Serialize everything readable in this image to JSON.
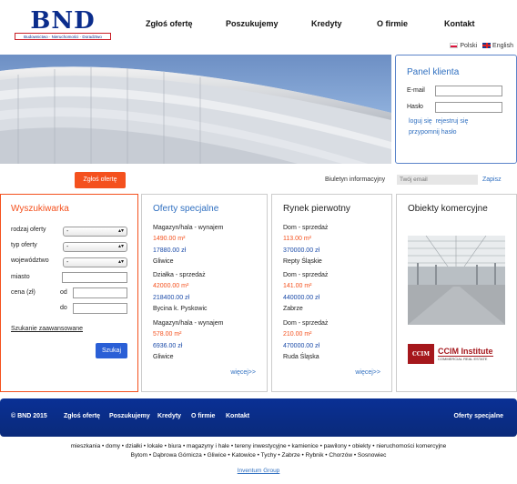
{
  "brand": {
    "name": "BND",
    "tagline": "Budownictwo · Nieruchomości · Doradztwo"
  },
  "nav": [
    "Zgłoś ofertę",
    "Poszukujemy",
    "Kredyty",
    "O firmie",
    "Kontakt"
  ],
  "languages": [
    "Polski",
    "English"
  ],
  "login": {
    "title": "Panel klienta",
    "email_label": "E-mail",
    "password_label": "Hasło",
    "login_link": "loguj się",
    "register_link": "rejestruj się",
    "remind_link": "przypomnij hasło"
  },
  "submit_offer_button": "Zgłoś ofertę",
  "newsletter": {
    "label": "Biuletyn informacyjny",
    "placeholder": "Twój email",
    "button": "Zapisz"
  },
  "search": {
    "title": "Wyszukiwarka",
    "fields": [
      {
        "label": "rodzaj oferty",
        "value": "-"
      },
      {
        "label": "typ oferty",
        "value": "-"
      },
      {
        "label": "województwo",
        "value": "-"
      }
    ],
    "city_label": "miasto",
    "price_label": "cena (zł)",
    "from_label": "od",
    "to_label": "do",
    "advanced_link": "Szukanie zaawansowane",
    "search_button": "Szukaj"
  },
  "special_offers": {
    "title": "Oferty specjalne",
    "items": [
      {
        "type": "Magazyn/hala - wynajem",
        "area": "1490.00 m²",
        "price": "17880.00 zł",
        "city": "Gliwice"
      },
      {
        "type": "Działka - sprzedaż",
        "area": "42000.00 m²",
        "price": "218400.00 zł",
        "city": "Bycina k. Pyskowic"
      },
      {
        "type": "Magazyn/hala - wynajem",
        "area": "578.00 m²",
        "price": "6936.00 zł",
        "city": "Gliwice"
      }
    ],
    "more": "więcej>>"
  },
  "primary_market": {
    "title": "Rynek pierwotny",
    "items": [
      {
        "type": "Dom - sprzedaż",
        "area": "113.00 m²",
        "price": "370000.00 zł",
        "city": "Repty Śląskie"
      },
      {
        "type": "Dom - sprzedaż",
        "area": "141.00 m²",
        "price": "440000.00 zł",
        "city": "Zabrze"
      },
      {
        "type": "Dom - sprzedaż",
        "area": "210.00 m²",
        "price": "470000.00 zł",
        "city": "Ruda Śląska"
      }
    ],
    "more": "więcej>>"
  },
  "commercial": {
    "title": "Obiekty komercyjne",
    "ccim_logo": "CCIM",
    "ccim_name": "CCIM Institute",
    "ccim_sub": "COMMERCIAL REAL ESTATE"
  },
  "footer": {
    "copyright": "© BND 2015",
    "links": [
      "Zgłoś ofertę",
      "Poszukujemy",
      "Kredyty",
      "O firmie",
      "Kontakt"
    ],
    "special": "Oferty specjalne"
  },
  "categories_line": "mieszkania • domy • działki • lokale • biura • magazyny i hale • tereny inwestycyjne • kamienice • pawilony • obiekty • nieruchomości komercyjne",
  "cities_line": "Bytom • Dąbrowa Górnicza • Gliwice • Katowice • Tychy • Zabrze • Rybnik • Chorzów • Sosnowiec",
  "credit": "Inventum Group",
  "colors": {
    "accent_orange": "#f4511e",
    "brand_blue": "#0a3095",
    "link_blue": "#2f6fc0"
  }
}
